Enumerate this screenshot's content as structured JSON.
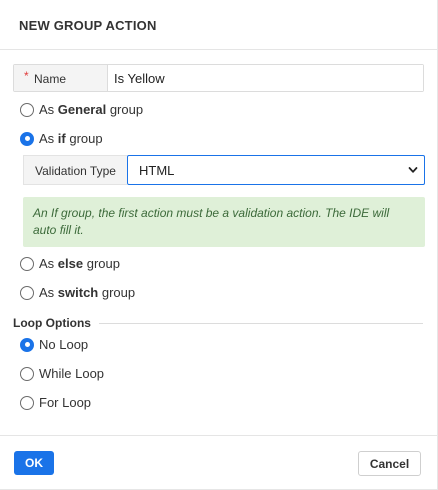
{
  "dialog": {
    "title": "NEW GROUP ACTION"
  },
  "name_field": {
    "label": "Name",
    "required_mark": "*",
    "value": "Is Yellow"
  },
  "group_types": [
    {
      "prefix": "As ",
      "bold": "General",
      "suffix": " group",
      "checked": false
    },
    {
      "prefix": "As ",
      "bold": "if",
      "suffix": " group",
      "checked": true
    },
    {
      "prefix": "As ",
      "bold": "else",
      "suffix": " group",
      "checked": false
    },
    {
      "prefix": "As ",
      "bold": "switch",
      "suffix": " group",
      "checked": false
    }
  ],
  "validation": {
    "label": "Validation Type",
    "selected": "HTML",
    "icon": "chevron-down-icon"
  },
  "info_message": "An If group, the first action must be a validation action. The IDE will auto fill it.",
  "loop_options": {
    "title": "Loop Options",
    "options": [
      {
        "label": "No Loop",
        "checked": true
      },
      {
        "label": "While Loop",
        "checked": false
      },
      {
        "label": "For Loop",
        "checked": false
      }
    ]
  },
  "buttons": {
    "ok": "OK",
    "cancel": "Cancel"
  },
  "colors": {
    "accent": "#1a73e8",
    "info_bg": "#dff0d8",
    "required": "#e03b3b"
  }
}
